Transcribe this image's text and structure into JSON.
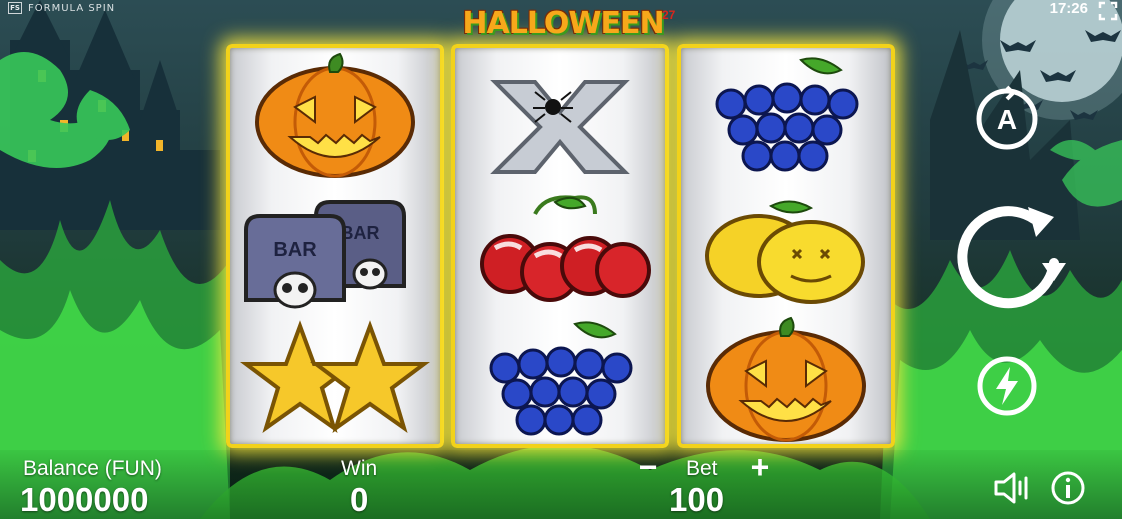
{
  "brand": {
    "logo_text": "FS",
    "name": "FORMULA SPIN"
  },
  "clock": "17:26",
  "title": {
    "text": "HALLOWEEN",
    "superscript": "27"
  },
  "reels": [
    [
      "pumpkin",
      "bar-tombstones",
      "stars"
    ],
    [
      "x-spider",
      "cherries",
      "grapes"
    ],
    [
      "grapes",
      "lemons",
      "pumpkin"
    ]
  ],
  "bar_symbol_text": "BAR",
  "controls": {
    "autoplay_label": "A",
    "autoplay_icon": "autoplay-icon",
    "spin_icon": "spin-icon",
    "turbo_icon": "lightning-icon"
  },
  "balance": {
    "label": "Balance (FUN)",
    "value": "1000000"
  },
  "win": {
    "label": "Win",
    "value": "0"
  },
  "bet": {
    "label": "Bet",
    "value": "100",
    "minus": "−",
    "plus": "+"
  },
  "colors": {
    "reel_frame": "#f2d21a",
    "flame": "#3fdd3a",
    "title": "#f7a81b"
  }
}
